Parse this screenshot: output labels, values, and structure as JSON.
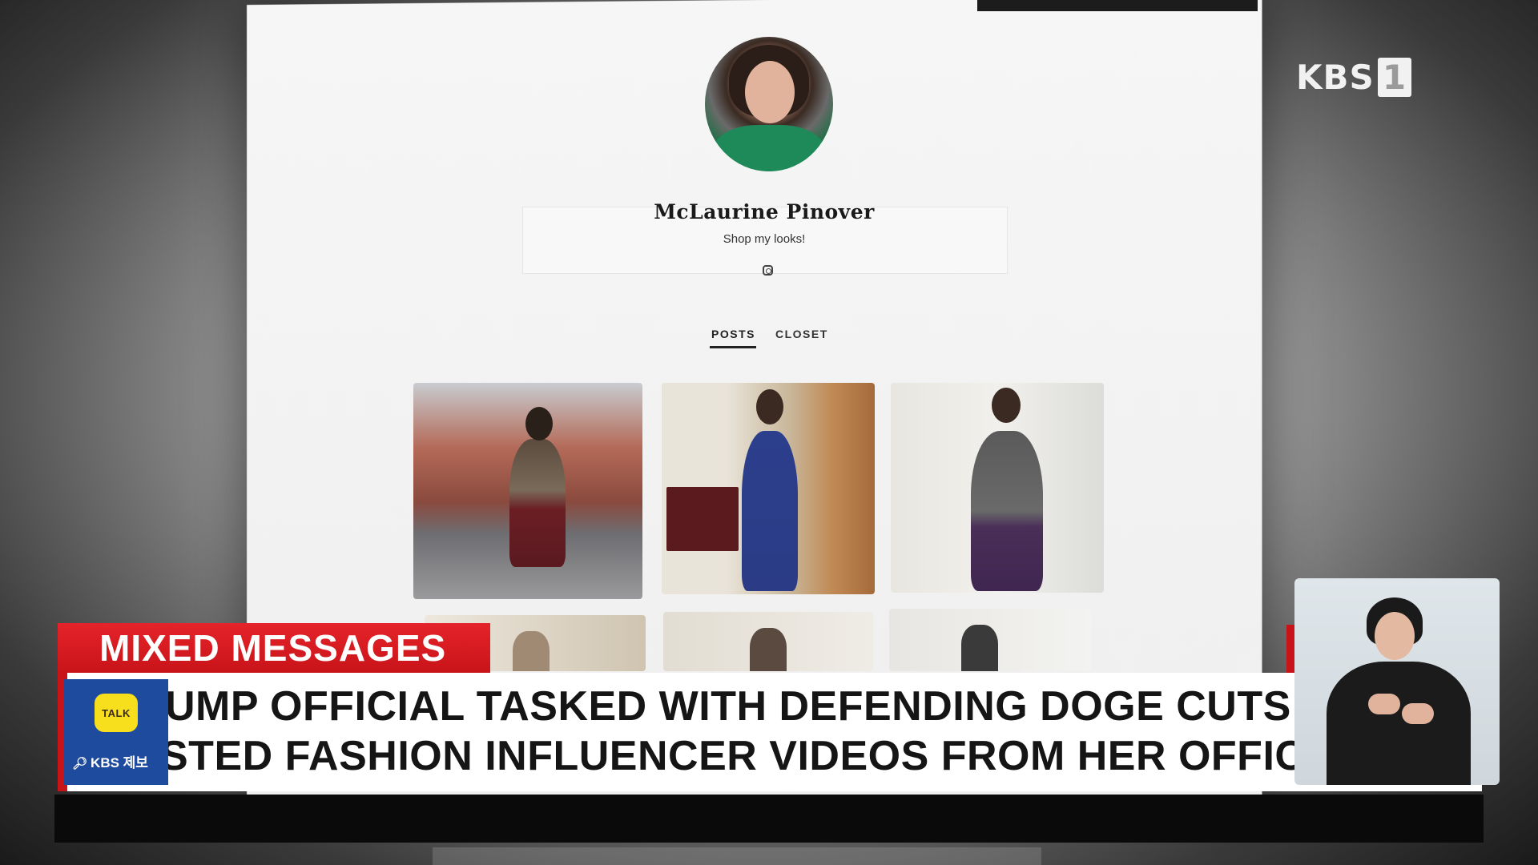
{
  "profile": {
    "name": "McLaurine Pinover",
    "bio": "Shop my looks!",
    "social_icon": "instagram-icon"
  },
  "tabs": [
    {
      "label": "POSTS",
      "active": true
    },
    {
      "label": "CLOSET",
      "active": false
    }
  ],
  "broadcaster": {
    "logo_text": "KBS",
    "logo_channel": "1"
  },
  "lower_third": {
    "tag": "MIXED MESSAGES",
    "line1": "UMP OFFICIAL TASKED WITH DEFENDING DOGE CUTS",
    "line2": "STED FASHION INFLUENCER VIDEOS FROM HER OFFICE"
  },
  "tip_box": {
    "bubble_text": "TALK",
    "label": "KBS 제보",
    "icon": "search-icon"
  },
  "colors": {
    "tag_red": "#c81419",
    "tip_blue": "#1e4b9e",
    "talk_yellow": "#f7df1e"
  }
}
